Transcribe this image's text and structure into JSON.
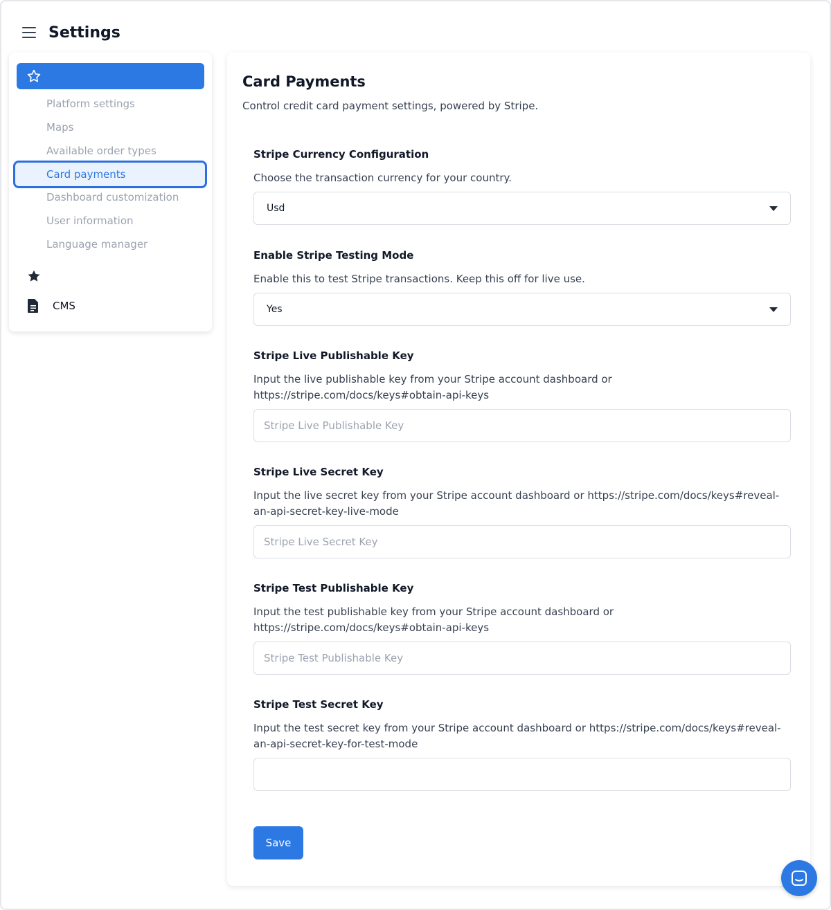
{
  "header": {
    "title": "Settings"
  },
  "sidebar": {
    "items": [
      {
        "label": "Platform settings"
      },
      {
        "label": "Maps"
      },
      {
        "label": "Available order types"
      },
      {
        "label": "Card payments"
      },
      {
        "label": "Dashboard customization"
      },
      {
        "label": "User information"
      },
      {
        "label": "Language manager"
      }
    ],
    "cms_label": "CMS",
    "accent_color": "#2d79e3"
  },
  "main": {
    "title": "Card Payments",
    "subtitle": "Control credit card payment settings, powered by Stripe.",
    "sections": [
      {
        "title": "Stripe Currency Configuration",
        "description": "Choose the transaction currency for your country.",
        "value": "Usd"
      },
      {
        "title": "Enable Stripe Testing Mode",
        "description": "Enable this to test Stripe transactions. Keep this off for live use.",
        "value": "Yes"
      },
      {
        "title": "Stripe Live Publishable Key",
        "description": "Input the live publishable key from your Stripe account dashboard or https://stripe.com/docs/keys#obtain-api-keys",
        "placeholder": "Stripe Live Publishable Key"
      },
      {
        "title": "Stripe Live Secret Key",
        "description": "Input the live secret key from your Stripe account dashboard or https://stripe.com/docs/keys#reveal-an-api-secret-key-live-mode",
        "placeholder": "Stripe Live Secret Key"
      },
      {
        "title": "Stripe Test Publishable Key",
        "description": "Input the test publishable key from your Stripe account dashboard or https://stripe.com/docs/keys#obtain-api-keys",
        "placeholder": "Stripe Test Publishable Key"
      },
      {
        "title": "Stripe Test Secret Key",
        "description": "Input the test secret key from your Stripe account dashboard or https://stripe.com/docs/keys#reveal-an-api-secret-key-for-test-mode",
        "placeholder": ""
      }
    ],
    "save_label": "Save"
  }
}
